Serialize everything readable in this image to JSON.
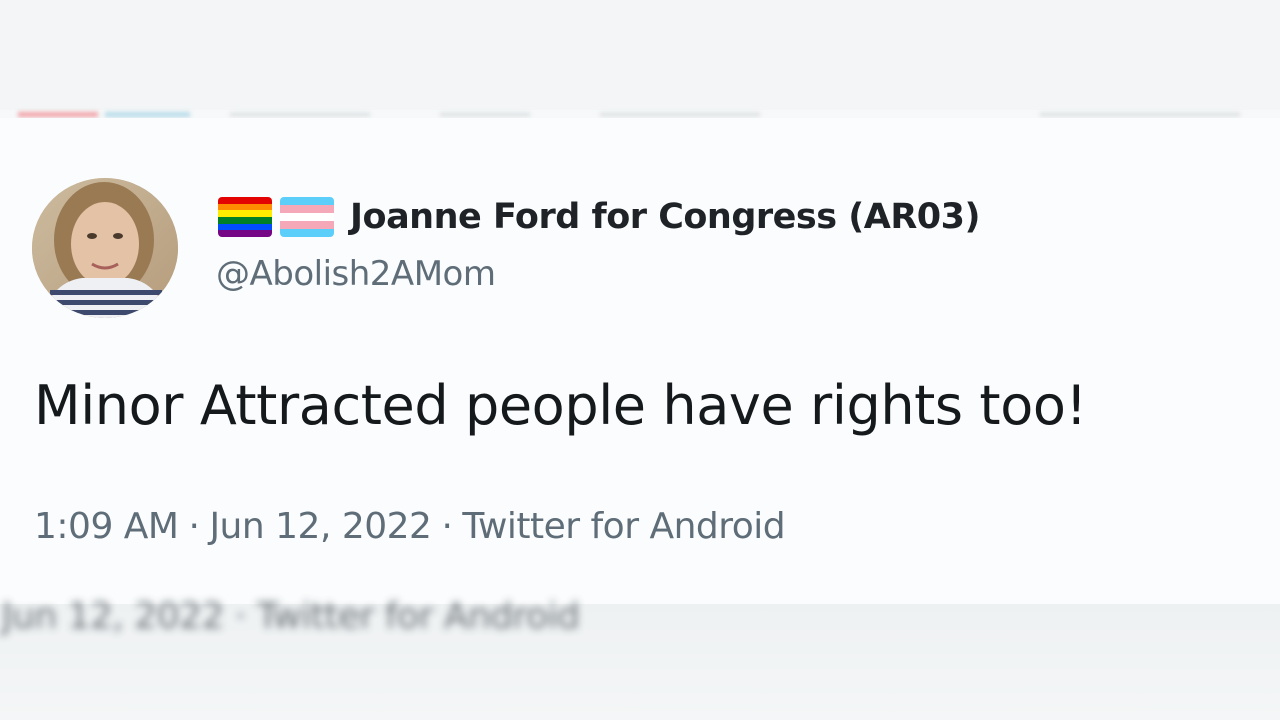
{
  "tweet": {
    "flags": [
      {
        "name": "rainbow-flag-icon",
        "colors": [
          "#e40303",
          "#ff8c00",
          "#ffed00",
          "#008026",
          "#004dff",
          "#750787"
        ]
      },
      {
        "name": "transgender-flag-icon",
        "colors": [
          "#5bcefa",
          "#f5a9b8",
          "#ffffff",
          "#f5a9b8",
          "#5bcefa"
        ]
      }
    ],
    "display_name": "Joanne Ford for Congress (AR03)",
    "handle": "@Abolish2AMom",
    "text": "Minor Attracted people have rights too!",
    "time": "1:09 AM",
    "separator": "·",
    "date": "Jun 12, 2022",
    "source": "Twitter for Android"
  },
  "colors": {
    "text_primary": "#15191c",
    "text_secondary": "#5e6d78",
    "card_bg": "#fafcfd"
  }
}
